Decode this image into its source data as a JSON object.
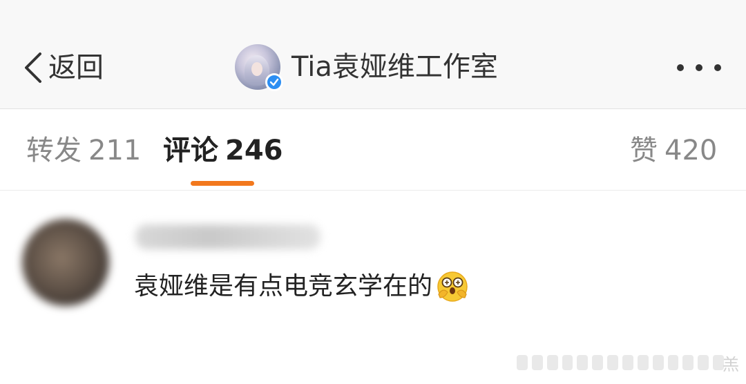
{
  "nav": {
    "back_label": "返回",
    "profile_name": "Tia袁娅维工作室",
    "avatar_icon": "user-avatar",
    "verify_icon": "verified-badge-icon",
    "verify_color": "#2c8ef2",
    "more_icon": "more-dots-icon"
  },
  "tabs": [
    {
      "label": "转发",
      "count": "211",
      "active": false
    },
    {
      "label": "评论",
      "count": "246",
      "active": true
    },
    {
      "label": "赞",
      "count": "420",
      "active": false
    }
  ],
  "accent_color": "#f2781d",
  "comment": {
    "text": "袁娅维是有点电竞玄学在的",
    "emoji_icon": "hugging-face-emoji"
  },
  "watermark": {
    "text": "羔"
  }
}
